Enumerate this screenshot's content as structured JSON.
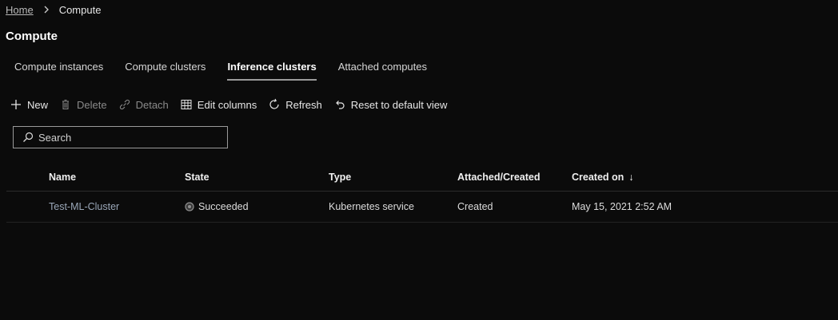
{
  "breadcrumb": {
    "home": "Home",
    "current": "Compute"
  },
  "page": {
    "title": "Compute"
  },
  "tabs": [
    {
      "label": "Compute instances",
      "active": false
    },
    {
      "label": "Compute clusters",
      "active": false
    },
    {
      "label": "Inference clusters",
      "active": true
    },
    {
      "label": "Attached computes",
      "active": false
    }
  ],
  "toolbar": {
    "new": "New",
    "delete": "Delete",
    "detach": "Detach",
    "edit_columns": "Edit columns",
    "refresh": "Refresh",
    "reset": "Reset to default view"
  },
  "search": {
    "placeholder": "Search",
    "value": ""
  },
  "table": {
    "headers": {
      "name": "Name",
      "state": "State",
      "type": "Type",
      "attached": "Attached/Created",
      "created_on": "Created on",
      "sort_indicator": "↓"
    },
    "rows": [
      {
        "name": "Test-ML-Cluster",
        "state": "Succeeded",
        "type": "Kubernetes service",
        "attached": "Created",
        "created_on": "May 15, 2021 2:52 AM"
      }
    ]
  },
  "icons": {
    "breadcrumb_separator": "chevron-right-icon",
    "new": "plus-icon",
    "delete": "trash-icon",
    "detach": "link-icon",
    "edit_columns": "columns-icon",
    "refresh": "refresh-icon",
    "reset": "undo-icon",
    "search": "search-icon",
    "state": "status-circle-icon"
  },
  "colors": {
    "background": "#0b0b0b",
    "link": "#9aa7b8",
    "disabled": "#8a8a8a"
  }
}
